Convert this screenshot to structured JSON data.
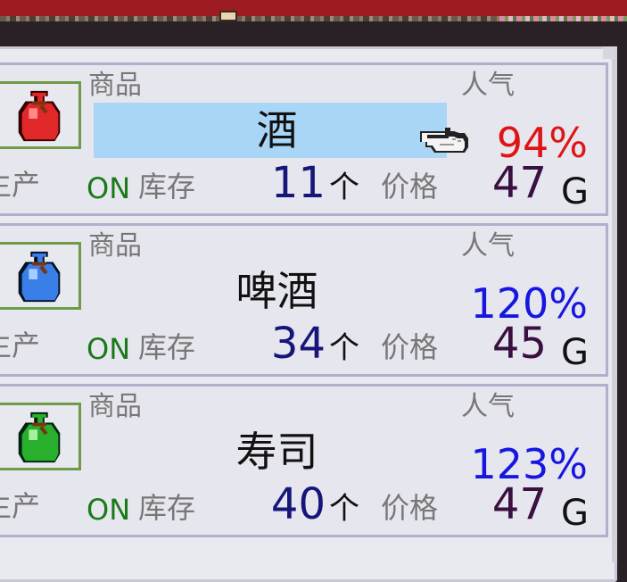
{
  "header": {},
  "labels": {
    "item": "商品",
    "popularity": "人气",
    "production": "生产",
    "stock": "库存",
    "price": "价格",
    "unit": "个",
    "currency": "G"
  },
  "items": [
    {
      "name": "酒",
      "popularity": "94%",
      "status": "ON",
      "stock": "11",
      "price": "47",
      "bag_color": "#e02828",
      "popularity_color": "#e01414",
      "selected": true
    },
    {
      "name": "啤酒",
      "popularity": "120%",
      "status": "ON",
      "stock": "34",
      "price": "45",
      "bag_color": "#3a7ee8",
      "popularity_color": "#1616e0",
      "selected": false
    },
    {
      "name": "寿司",
      "popularity": "123%",
      "status": "ON",
      "stock": "40",
      "price": "47",
      "bag_color": "#28b02c",
      "popularity_color": "#1616e0",
      "selected": false
    }
  ],
  "icons": {
    "cursor": "pointing-hand-icon",
    "bag": "sack-icon"
  }
}
